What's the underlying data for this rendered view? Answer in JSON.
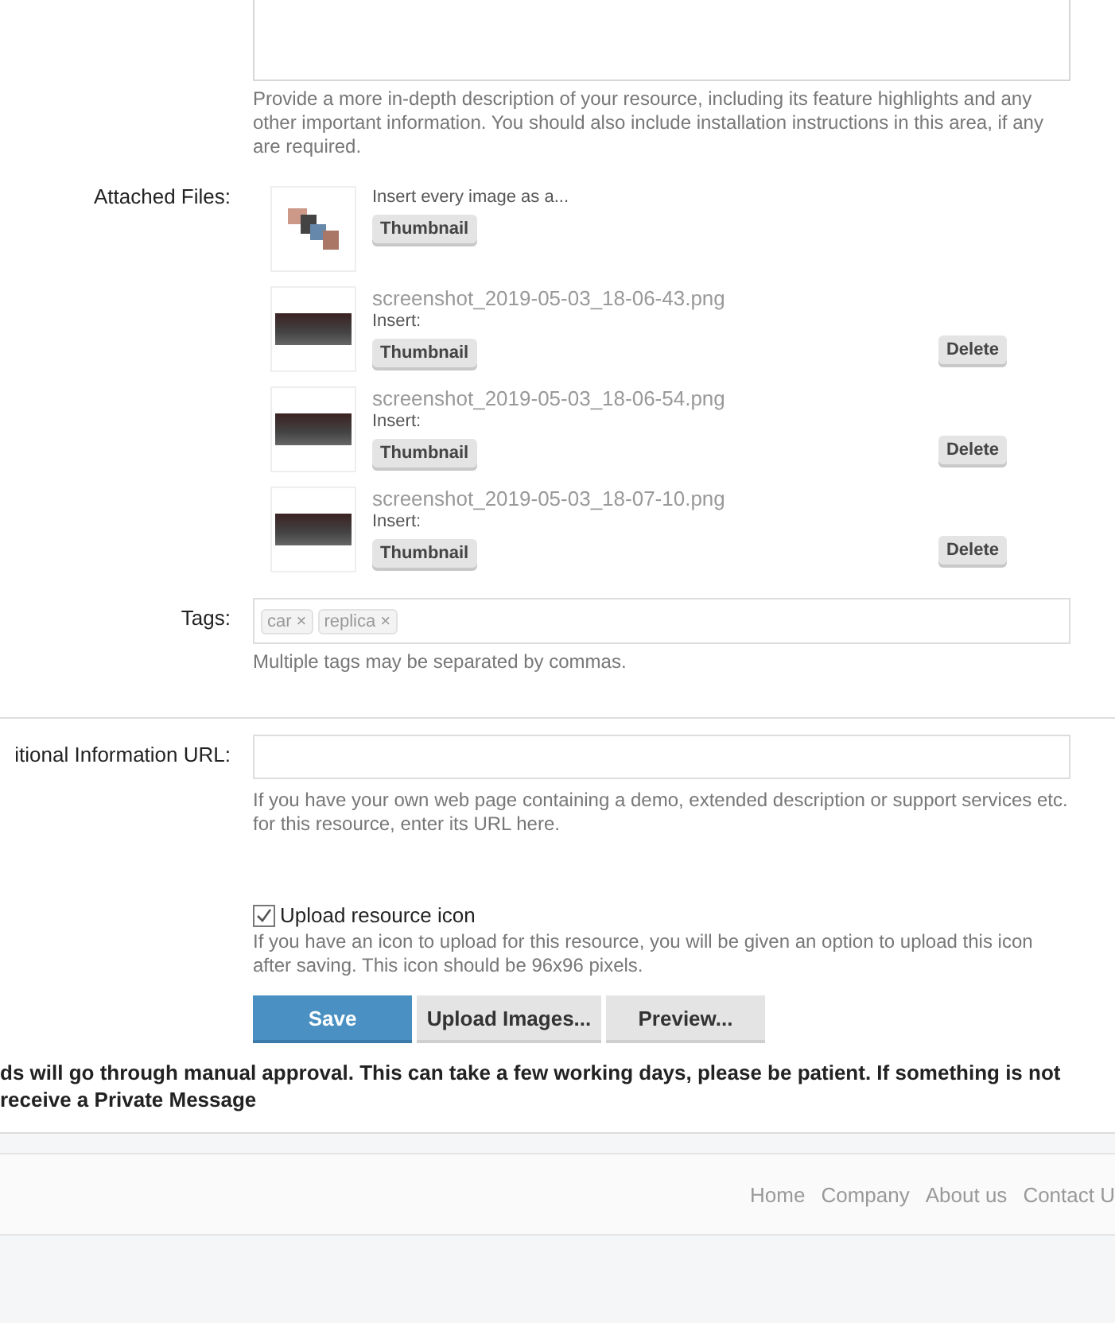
{
  "description_hint": "Provide a more in-depth description of your resource, including its feature highlights and any other important information. You should also include installation instructions in this area, if any are required.",
  "attached_files": {
    "label": "Attached Files:",
    "insert_all": {
      "caption": "Insert every image as a...",
      "button": "Thumbnail"
    },
    "files": [
      {
        "name": "screenshot_2019-05-03_18-06-43.png",
        "insert_label": "Insert:",
        "insert_button": "Thumbnail",
        "delete_button": "Delete"
      },
      {
        "name": "screenshot_2019-05-03_18-06-54.png",
        "insert_label": "Insert:",
        "insert_button": "Thumbnail",
        "delete_button": "Delete"
      },
      {
        "name": "screenshot_2019-05-03_18-07-10.png",
        "insert_label": "Insert:",
        "insert_button": "Thumbnail",
        "delete_button": "Delete"
      }
    ]
  },
  "tags": {
    "label": "Tags:",
    "items": [
      "car",
      "replica"
    ],
    "remove_glyph": "×",
    "hint": "Multiple tags may be separated by commas."
  },
  "url_field": {
    "label": "itional Information URL:",
    "hint": "If you have your own web page containing a demo, extended description or support services etc. for this resource, enter its URL here."
  },
  "upload_icon": {
    "label": "Upload resource icon",
    "checked": true,
    "hint": "If you have an icon to upload for this resource, you will be given an option to upload this icon after saving. This icon should be 96x96 pixels."
  },
  "buttons": [
    {
      "label": "Save",
      "kind": "primary"
    },
    {
      "label": "Upload Images...",
      "kind": "secondary"
    },
    {
      "label": "Preview...",
      "kind": "secondary"
    }
  ],
  "notice_lines": [
    "ds will go through manual approval. This can take a few working days, please be patient. If something is not",
    "receive a Private Message"
  ],
  "footer_links": [
    "Home",
    "Company",
    "About us",
    "Contact U"
  ]
}
